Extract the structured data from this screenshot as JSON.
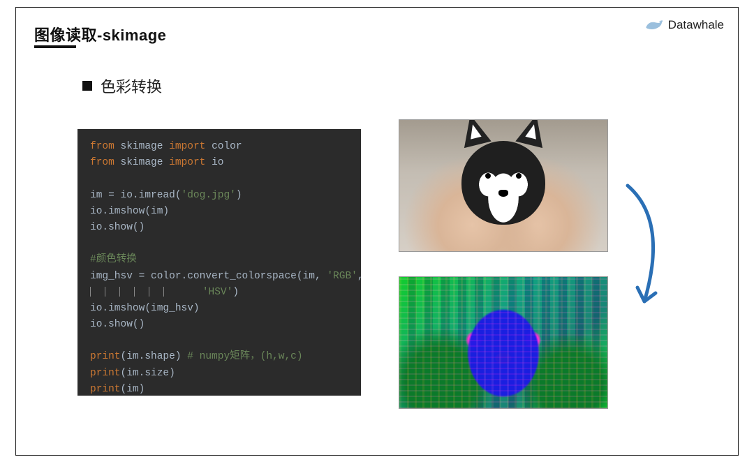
{
  "brand": {
    "name": "Datawhale"
  },
  "title": "图像读取-skimage",
  "subtitle": "色彩转换",
  "code": {
    "l1_from": "from",
    "l1_mod": "skimage",
    "l1_import": "import",
    "l1_item": "color",
    "l2_from": "from",
    "l2_mod": "skimage",
    "l2_import": "import",
    "l2_item": "io",
    "l3": "im = io.imread(",
    "l3_str": "'dog.jpg'",
    "l3_end": ")",
    "l4": "io.imshow(im)",
    "l5": "io.show()",
    "l6_cmt": "#颜色转换",
    "l7a": "img_hsv = color.convert_colorspace(im, ",
    "l7b": "'RGB'",
    "l7c": ",",
    "l8_str": "'HSV'",
    "l8_end": ")",
    "l9": "io.imshow(img_hsv)",
    "l10": "io.show()",
    "l11a": "print",
    "l11b": "(im.shape) ",
    "l11_cmt": "# numpy矩阵，(h,w,c)",
    "l12a": "print",
    "l12b": "(im.size)",
    "l13a": "print",
    "l13b": "(im)"
  },
  "images": {
    "original_label": "dog-original-rgb",
    "converted_label": "dog-hsv-colorspace"
  }
}
